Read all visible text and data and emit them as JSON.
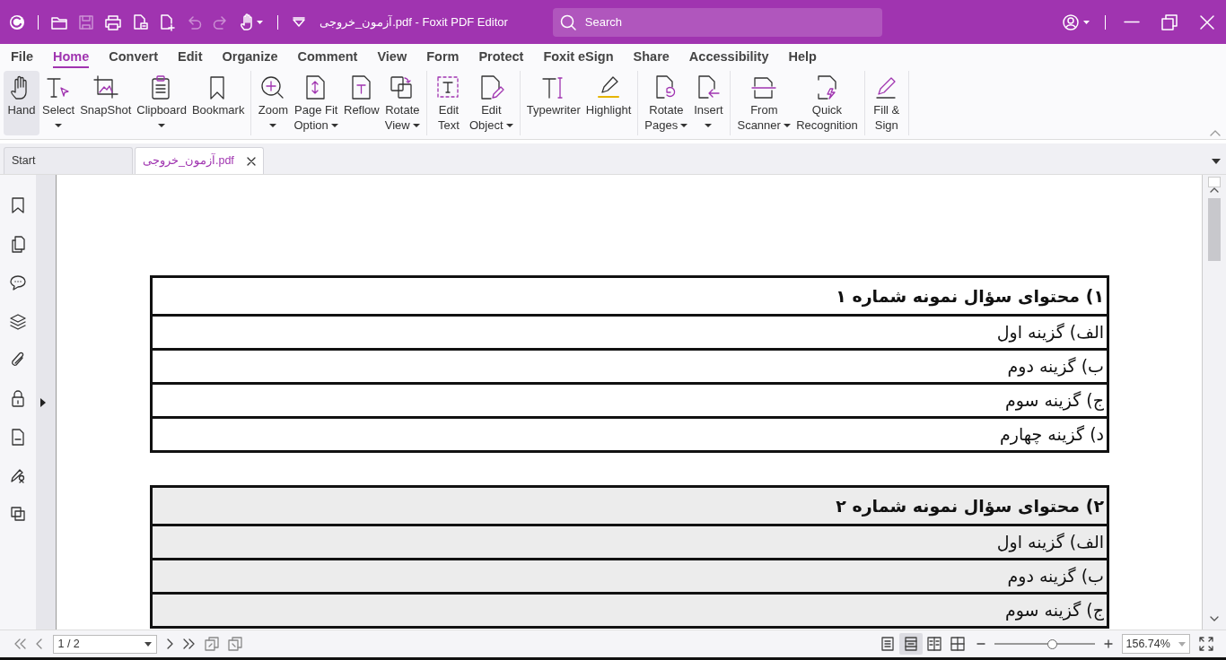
{
  "window": {
    "title": "آزمون_خروجی.pdf - Foxit PDF Editor"
  },
  "quick_access": [
    {
      "disabled": false
    },
    {
      "disabled": false
    },
    {
      "disabled": true
    },
    {
      "disabled": false
    },
    {
      "disabled": false
    },
    {
      "disabled": false
    },
    {
      "disabled": true
    },
    {
      "disabled": true
    },
    {
      "disabled": false
    }
  ],
  "search": {
    "placeholder": "Search"
  },
  "menu_tabs": [
    {
      "label": "File",
      "selected": false
    },
    {
      "label": "Home",
      "selected": true
    },
    {
      "label": "Convert",
      "selected": false
    },
    {
      "label": "Edit",
      "selected": false
    },
    {
      "label": "Organize",
      "selected": false
    },
    {
      "label": "Comment",
      "selected": false
    },
    {
      "label": "View",
      "selected": false
    },
    {
      "label": "Form",
      "selected": false
    },
    {
      "label": "Protect",
      "selected": false
    },
    {
      "label": "Foxit eSign",
      "selected": false
    },
    {
      "label": "Share",
      "selected": false
    },
    {
      "label": "Accessibility",
      "selected": false
    },
    {
      "label": "Help",
      "selected": false
    }
  ],
  "ribbon_groups": [
    [
      {
        "lines": [
          "Hand"
        ],
        "dropdown": false,
        "selected": true
      },
      {
        "lines": [
          "Select"
        ],
        "dropdown": true,
        "selected": false
      },
      {
        "lines": [
          "SnapShot"
        ],
        "dropdown": false,
        "selected": false
      },
      {
        "lines": [
          "Clipboard"
        ],
        "dropdown": true,
        "selected": false
      },
      {
        "lines": [
          "Bookmark"
        ],
        "dropdown": false,
        "selected": false
      }
    ],
    [
      {
        "lines": [
          "Zoom"
        ],
        "dropdown": true,
        "selected": false
      },
      {
        "lines": [
          "Page Fit",
          "Option"
        ],
        "dropdown": true,
        "selected": false
      },
      {
        "lines": [
          "Reflow"
        ],
        "dropdown": false,
        "selected": false
      },
      {
        "lines": [
          "Rotate",
          "View"
        ],
        "dropdown": true,
        "selected": false
      }
    ],
    [
      {
        "lines": [
          "Edit",
          "Text"
        ],
        "dropdown": false,
        "selected": false
      },
      {
        "lines": [
          "Edit",
          "Object"
        ],
        "dropdown": true,
        "selected": false
      }
    ],
    [
      {
        "lines": [
          "Typewriter"
        ],
        "dropdown": false,
        "selected": false
      },
      {
        "lines": [
          "Highlight"
        ],
        "dropdown": false,
        "selected": false
      }
    ],
    [
      {
        "lines": [
          "Rotate",
          "Pages"
        ],
        "dropdown": true,
        "selected": false
      },
      {
        "lines": [
          "Insert"
        ],
        "dropdown": true,
        "selected": false
      }
    ],
    [
      {
        "lines": [
          "From",
          "Scanner"
        ],
        "dropdown": true,
        "selected": false
      },
      {
        "lines": [
          "Quick",
          "Recognition"
        ],
        "dropdown": false,
        "selected": false
      }
    ],
    [
      {
        "lines": [
          "Fill &",
          "Sign"
        ],
        "dropdown": false,
        "selected": false
      }
    ]
  ],
  "doc_tabs": [
    {
      "label": "Start",
      "selected": false
    },
    {
      "label": "آزمون_خروجی.pdf",
      "selected": true
    }
  ],
  "document": {
    "tables": [
      {
        "shaded": false,
        "rows": [
          {
            "text": "۱) محتوای سؤال نمونه شماره ۱",
            "kind": "question"
          },
          {
            "text": "الف) گزینه اول",
            "kind": "option"
          },
          {
            "text": "ب) گزینه دوم",
            "kind": "option"
          },
          {
            "text": "ج) گزینه سوم",
            "kind": "option"
          },
          {
            "text": "د) گزینه چهارم",
            "kind": "option"
          }
        ]
      },
      {
        "shaded": true,
        "rows": [
          {
            "text": "۲) محتوای سؤال نمونه شماره ۲",
            "kind": "question"
          },
          {
            "text": "الف) گزینه اول",
            "kind": "option"
          },
          {
            "text": "ب) گزینه دوم",
            "kind": "option"
          },
          {
            "text": "ج) گزینه سوم",
            "kind": "option"
          }
        ]
      }
    ]
  },
  "status_bar": {
    "page": "1 / 2",
    "view_modes": [
      {
        "selected": false
      },
      {
        "selected": true
      },
      {
        "selected": false
      },
      {
        "selected": false
      }
    ],
    "zoom_slider": {
      "level": 0.57
    },
    "zoom": "156.74%"
  }
}
